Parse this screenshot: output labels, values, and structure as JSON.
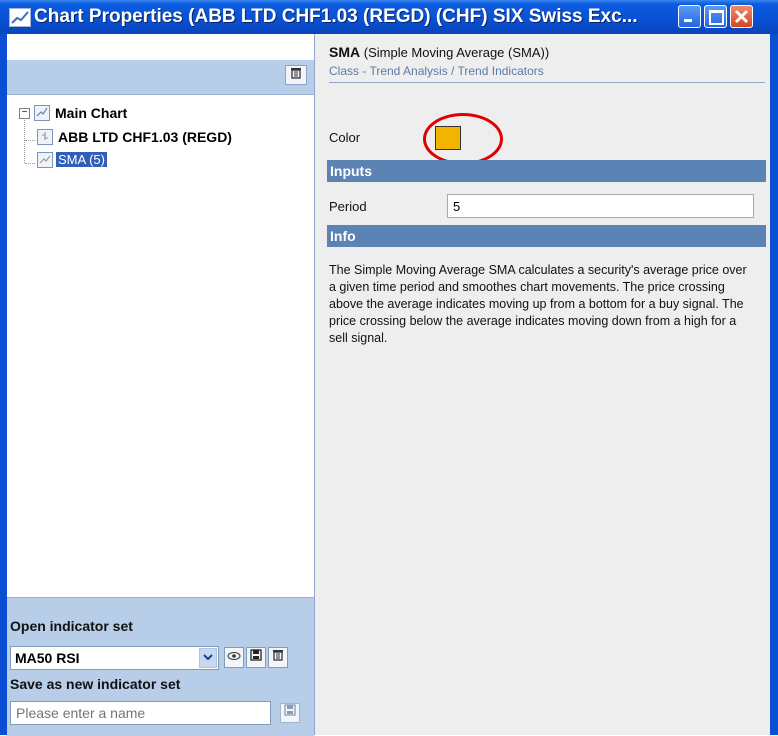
{
  "window": {
    "title": "Chart Properties (ABB LTD CHF1.03 (REGD) (CHF) SIX Swiss Exc..."
  },
  "left_pane": {
    "tree": {
      "root_label": "Main Chart",
      "root_expander": "−",
      "children": [
        {
          "label": "ABB LTD CHF1.03 (REGD)"
        },
        {
          "label": "SMA (5)"
        }
      ]
    },
    "open_indicator_set": {
      "title": "Open indicator set",
      "selected": "MA50 RSI"
    },
    "save_new_set": {
      "title": "Save as new indicator set",
      "placeholder": "Please enter a name"
    }
  },
  "right_pane": {
    "indicator": {
      "name": "SMA",
      "full_name": "(Simple Moving Average (SMA))",
      "class_text": "Class - Trend Analysis / Trend Indicators"
    },
    "color_label": "Color",
    "color_value": "#f3b400",
    "inputs_header": "Inputs",
    "period_label": "Period",
    "period_value": "5",
    "info_header": "Info",
    "info_text": "The Simple Moving Average SMA calculates a security's average price over a given time period and smoothes chart movements. The price crossing above the average indicates moving up from a bottom for a buy signal. The price crossing below the average indicates moving down from a high for a sell signal."
  },
  "icons": [
    "chart-icon",
    "minimize-icon",
    "maximize-icon",
    "close-icon",
    "trash-icon",
    "chevron-down-icon",
    "eye-icon",
    "save-icon"
  ],
  "colors": {
    "titlebar": "#0a4fd3",
    "section_header": "#5b84b5",
    "panel": "#b7cde8",
    "highlight": "#e00000"
  }
}
